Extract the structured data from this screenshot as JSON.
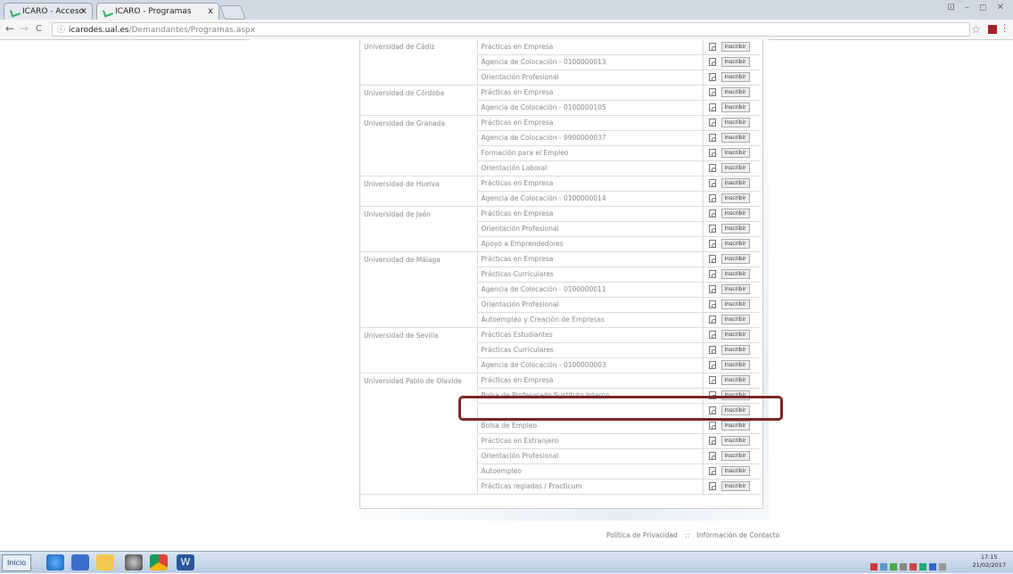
{
  "browser": {
    "tabs": [
      {
        "label": "ICARO - Acceso",
        "close": "x"
      },
      {
        "label": "ICARO - Programas",
        "close": "x"
      }
    ],
    "window_controls": "⊡ – ◻ ✕",
    "url_host": "icarodes.ual.es",
    "url_path": "/Demandantes/Programas.aspx",
    "back": "←",
    "forward": "→",
    "reload": "C",
    "star": "☆",
    "menu": "⋮"
  },
  "button_label": "Inscribir",
  "programs": [
    {
      "uni": "Universidad de Cádiz",
      "rows": [
        "Prácticas en Empresa",
        "Agencia de Colocación - 0100000013",
        "Orientación Profesional"
      ]
    },
    {
      "uni": "Universidad de Córdoba",
      "rows": [
        "Prácticas en Empresa",
        "Agencia de Colocación - 0100000105"
      ]
    },
    {
      "uni": "Universidad de Granada",
      "rows": [
        "Prácticas en Empresa",
        "Agencia de Colocación - 9900000037",
        "Formación para el Empleo",
        "Orientación Laboral"
      ]
    },
    {
      "uni": "Universidad de Huelva",
      "rows": [
        "Prácticas en Empresa",
        "Agencia de Colocación - 0100000014"
      ]
    },
    {
      "uni": "Universidad de Jaén",
      "rows": [
        "Prácticas en Empresa",
        "Orientación Profesional",
        "Apoyo a Emprendedores"
      ]
    },
    {
      "uni": "Universidad de Málaga",
      "rows": [
        "Prácticas en Empresa",
        "Prácticas Curriculares",
        "Agencia de Colocación - 0100000011",
        "Orientación Profesional",
        "Autoempleo y Creación de Empresas"
      ]
    },
    {
      "uni": "Universidad de Sevilla",
      "rows": [
        "Prácticas Estudiantes",
        "Prácticas Curriculares",
        "Agencia de Colocación - 0100000003"
      ]
    },
    {
      "uni": "Universidad Pablo de Olavide",
      "rows": [
        "Prácticas en Empresa",
        "Bolsa de Profesorado Sustituto Interno",
        "",
        "Bolsa de Empleo",
        "Prácticas en Extranjero",
        "Orientación Profesional",
        "Autoempleo",
        "Prácticas regladas / Practicum"
      ]
    }
  ],
  "footer": {
    "privacy": "Política de Privacidad",
    "separator": "::",
    "contact": "Información de Contacto"
  },
  "taskbar": {
    "start": "Inicio",
    "time": "17:15",
    "date": "21/02/2017"
  },
  "colors": {
    "highlight": "#7d2525"
  }
}
